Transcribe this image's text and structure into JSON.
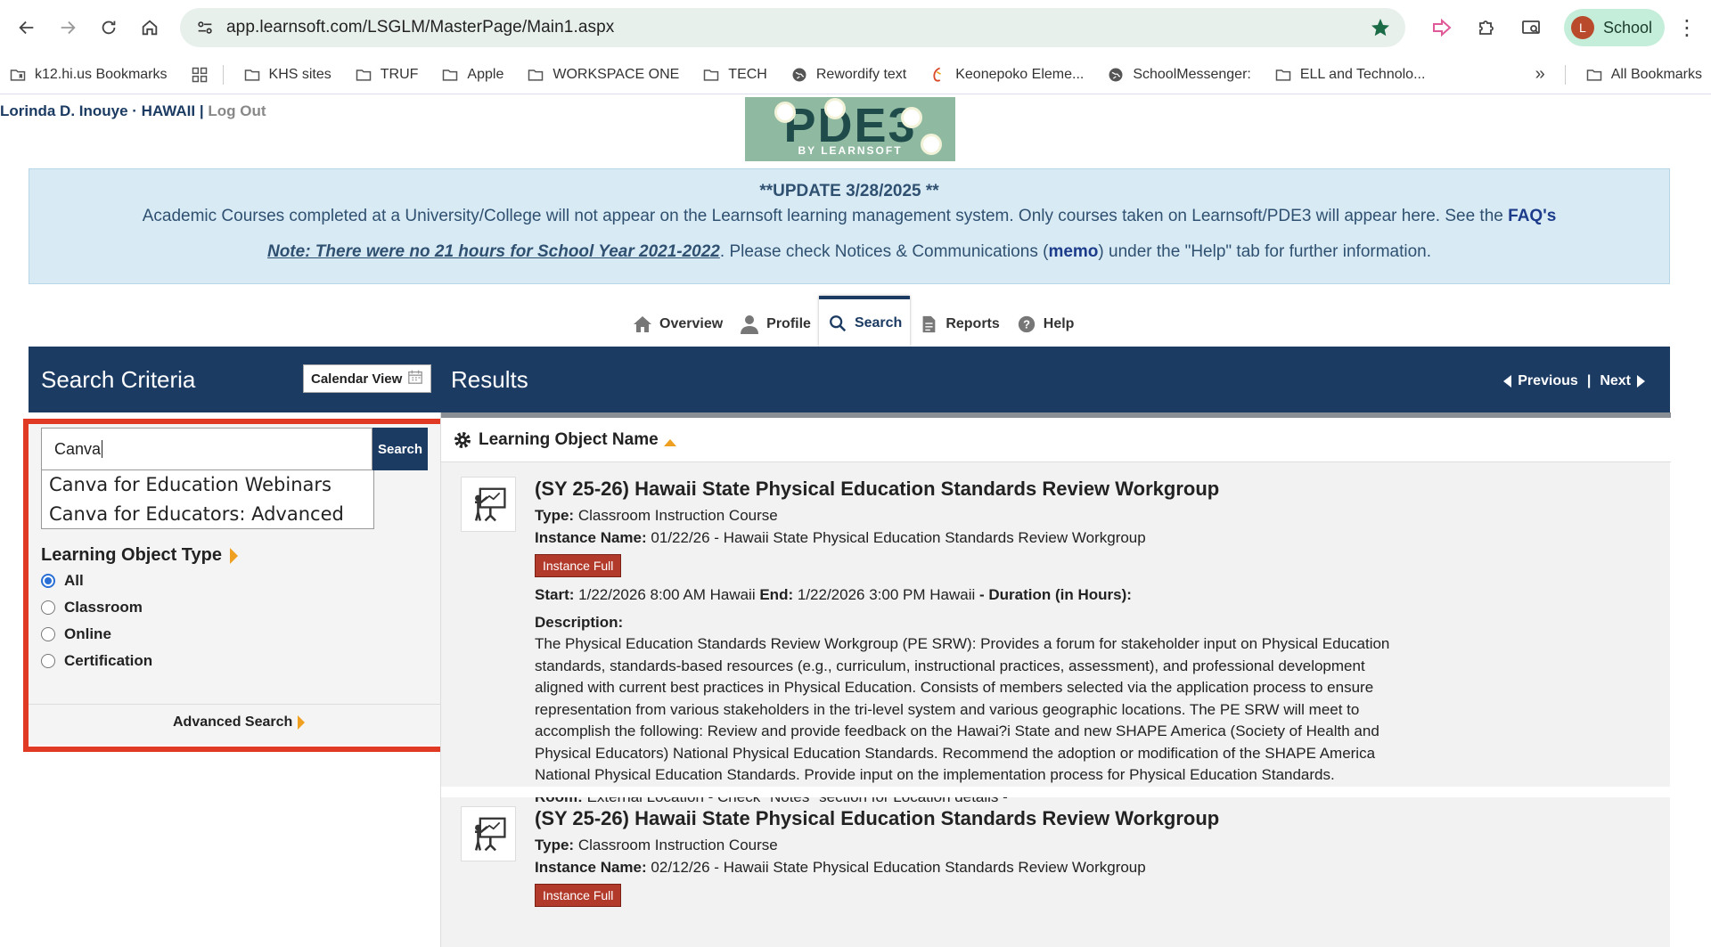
{
  "browser": {
    "url": "app.learnsoft.com/LSGLM/MasterPage/Main1.aspx",
    "profile_initial": "L",
    "profile_label": "School",
    "bookmarks": [
      {
        "label": "k12.hi.us Bookmarks",
        "icon": "bookmark-folder-icon"
      },
      {
        "label": "KHS sites",
        "icon": "folder-icon"
      },
      {
        "label": "TRUF",
        "icon": "folder-icon"
      },
      {
        "label": "Apple",
        "icon": "folder-icon"
      },
      {
        "label": "WORKSPACE ONE",
        "icon": "folder-icon"
      },
      {
        "label": "TECH",
        "icon": "folder-icon"
      },
      {
        "label": "Rewordify text",
        "icon": "globe-icon"
      },
      {
        "label": "Keonepoko Eleme...",
        "icon": "site-icon"
      },
      {
        "label": "SchoolMessenger:",
        "icon": "globe-icon"
      },
      {
        "label": "ELL and Technolo...",
        "icon": "folder-icon"
      }
    ],
    "more_bookmarks": "»",
    "all_bookmarks": "All Bookmarks"
  },
  "user": {
    "name": "Lorinda D. Inouye · HAWAII |",
    "logout": "Log Out"
  },
  "logo": {
    "main": "PDE3",
    "sub": "BY LEARNSOFT"
  },
  "notice": {
    "title": "**UPDATE 3/28/2025 **",
    "line1": "Academic Courses completed at a University/College will not appear on the Learnsoft learning management system.  Only courses taken on Learnsoft/PDE3 will appear here.  See the",
    "faq": "FAQ's",
    "note": "Note:  There were no 21 hours for School Year 2021-2022",
    "line2a": ". Please check Notices & Communications (",
    "memo": "memo",
    "line2b": ") under the \"Help\" tab for further information."
  },
  "tabs": [
    {
      "label": "Overview",
      "icon": "home-icon"
    },
    {
      "label": "Profile",
      "icon": "user-icon"
    },
    {
      "label": "Search",
      "icon": "search-icon",
      "active": true
    },
    {
      "label": "Reports",
      "icon": "document-icon"
    },
    {
      "label": "Help",
      "icon": "help-icon"
    }
  ],
  "toolbar": {
    "search_criteria": "Search Criteria",
    "calendar_view": "Calendar View",
    "results": "Results",
    "previous": "Previous",
    "separator": "|",
    "next": "Next"
  },
  "search": {
    "value": "Canva",
    "button": "Search",
    "suggestions": [
      "Canva for Education Webinars",
      "Canva for Educators: Advanced"
    ]
  },
  "filters": {
    "title": "Learning Object Type",
    "options": [
      "All",
      "Classroom",
      "Online",
      "Certification"
    ],
    "selected": "All",
    "advanced": "Advanced Search"
  },
  "results": {
    "column": "Learning Object Name",
    "items": [
      {
        "title": "(SY 25-26) Hawaii State Physical Education Standards Review Workgroup",
        "type_label": "Type:",
        "type": "Classroom Instruction Course",
        "instance_label": "Instance Name:",
        "instance": "01/22/26 - Hawaii State Physical Education Standards Review Workgroup",
        "badge": "Instance Full",
        "start_label": "Start:",
        "start": "1/22/2026 8:00 AM Hawaii",
        "end_label": "End:",
        "end": "1/22/2026 3:00 PM Hawaii",
        "duration_label": "- Duration (in Hours):",
        "description_label": "Description:",
        "description": "The Physical Education Standards Review Workgroup (PE SRW): Provides a forum for stakeholder input on Physical Education standards, standards-based resources (e.g., curriculum, instructional practices, assessment), and professional development aligned with current best practices in Physical Education. Consists of members selected via the application process to ensure representation from various stakeholders in the tri-level system and various geographic locations. The PE SRW will meet to accomplish the following: Review and provide feedback on the Hawai?i State and new SHAPE America (Society of Health and Physical Educators) National Physical Education Standards. Recommend the adoption or modification of the SHAPE America National Physical Education Standards. Provide input on the implementation process for Physical Education Standards.",
        "room_label": "Room:",
        "room": "External Location - Check \"Notes\" section for Location details -"
      },
      {
        "title": "(SY 25-26) Hawaii State Physical Education Standards Review Workgroup",
        "type_label": "Type:",
        "type": "Classroom Instruction Course",
        "instance_label": "Instance Name:",
        "instance": "02/12/26 - Hawaii State Physical Education Standards Review Workgroup",
        "badge": "Instance Full"
      }
    ]
  },
  "colors": {
    "navy": "#1c3b63",
    "highlight": "#e03a24",
    "badge": "#b23a2a",
    "accent": "#f0a020"
  }
}
